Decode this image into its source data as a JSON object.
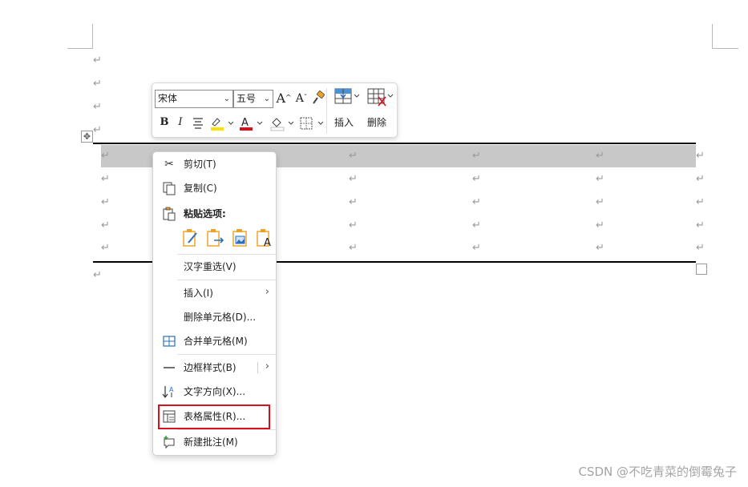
{
  "paragraph_mark": "↵",
  "toolbar": {
    "font_name": "宋体",
    "font_size": "五号",
    "grow_font": "A",
    "shrink_font": "A",
    "bold": "B",
    "italic": "I",
    "insert_label": "插入",
    "delete_label": "删除"
  },
  "menu": {
    "cut": "剪切(T)",
    "copy": "复制(C)",
    "paste_options": "粘贴选项:",
    "reconvert": "汉字重选(V)",
    "insert": "插入(I)",
    "delete_cells": "删除单元格(D)...",
    "merge_cells": "合并单元格(M)",
    "border_styles": "边框样式(B)",
    "text_direction": "文字方向(X)...",
    "table_properties": "表格属性(R)...",
    "new_comment": "新建批注(M)"
  },
  "watermark": "CSDN @不吃青菜的倒霉兔子",
  "colors": {
    "highlight_yellow": "#ffe000",
    "font_red": "#d8101c",
    "selection_gray": "#c8c8c8",
    "outline_red": "#d9101c"
  }
}
